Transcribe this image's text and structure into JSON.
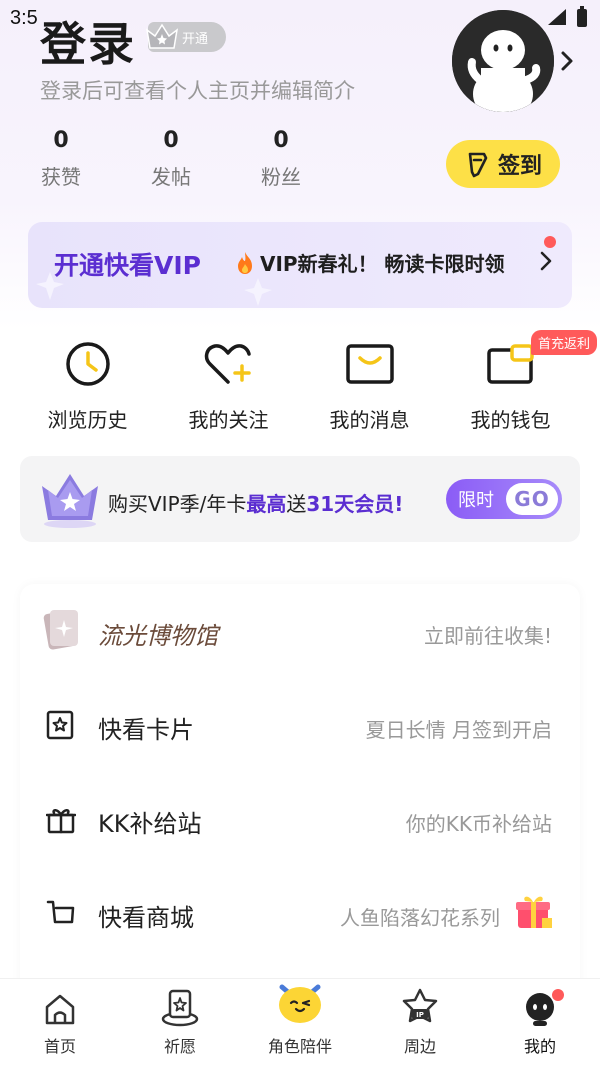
{
  "status": {
    "time": "3:5"
  },
  "header": {
    "title": "登录",
    "vip_tag": "开通",
    "subtitle": "登录后可查看个人主页并编辑简介"
  },
  "stats": [
    {
      "num": "0",
      "label": "获赞"
    },
    {
      "num": "0",
      "label": "发帖"
    },
    {
      "num": "0",
      "label": "粉丝"
    }
  ],
  "signin": {
    "label": "签到"
  },
  "vip_banner": {
    "title": "开通快看VIP",
    "promo": "VIP新春礼！ 畅读卡限时领"
  },
  "quick": [
    {
      "label": "浏览历史"
    },
    {
      "label": "我的关注"
    },
    {
      "label": "我的消息"
    },
    {
      "label": "我的钱包",
      "badge": "首充返利"
    }
  ],
  "vip_promo": {
    "text_a": "购买VIP季/年卡",
    "text_b": "最高",
    "text_c": "送",
    "text_d": "31天会员!",
    "limited": "限时",
    "go": "GO"
  },
  "menu": [
    {
      "label": "流光博物馆",
      "right": "立即前往收集!"
    },
    {
      "label": "快看卡片",
      "right": "夏日长情 月签到开启"
    },
    {
      "label": "KK补给站",
      "right": "你的KK币补给站"
    },
    {
      "label": "快看商城",
      "right": "人鱼陷落幻花系列"
    }
  ],
  "tabs": [
    {
      "label": "首页"
    },
    {
      "label": "祈愿"
    },
    {
      "label": "角色陪伴"
    },
    {
      "label": "周边"
    },
    {
      "label": "我的"
    }
  ],
  "colors": {
    "accent_purple": "#5b2ed1",
    "signin_yellow": "#fde047",
    "badge_red": "#ff5a5a"
  }
}
